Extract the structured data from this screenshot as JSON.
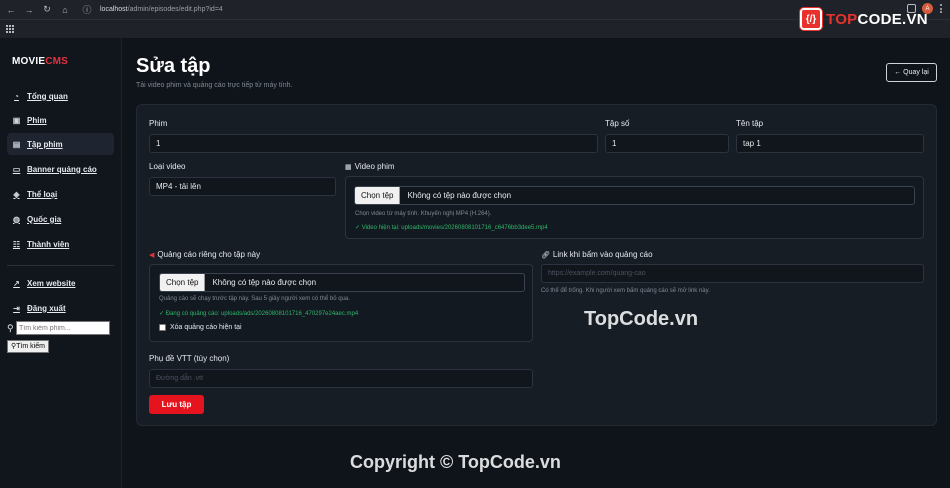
{
  "browser": {
    "url_host": "localhost",
    "url_path": "/admin/episodes/edit.php?id=4"
  },
  "watermark_logo": {
    "badge": "{/}",
    "text_a": "TOP",
    "text_b": "CODE.VN"
  },
  "avatar_letter": "A",
  "brand": {
    "a": "MOVIE",
    "b": "CMS"
  },
  "sidebar": {
    "items": [
      {
        "label": "Tổng quan",
        "icon": "gauge-icon"
      },
      {
        "label": "Phim",
        "icon": "film-icon"
      },
      {
        "label": "Tập phim",
        "icon": "clapper-icon",
        "active": true
      },
      {
        "label": "Banner quảng cáo",
        "icon": "ad-icon"
      },
      {
        "label": "Thể loại",
        "icon": "tag-icon"
      },
      {
        "label": "Quốc gia",
        "icon": "globe-icon"
      },
      {
        "label": "Thành viên",
        "icon": "users-icon"
      }
    ],
    "links": [
      {
        "label": "Xem website",
        "icon": "external-link-icon"
      },
      {
        "label": "Đăng xuất",
        "icon": "logout-icon"
      }
    ],
    "search": {
      "placeholder": "Tìm kiếm phim...",
      "button": "Tìm kiếm"
    }
  },
  "page": {
    "title": "Sửa tập",
    "subtitle": "Tải video phim và quảng cáo trực tiếp từ máy tính.",
    "back": "← Quay lại"
  },
  "form": {
    "movie": {
      "label": "Phim",
      "value": "1"
    },
    "episode_no": {
      "label": "Tập số",
      "value": "1"
    },
    "episode_name": {
      "label": "Tên tập",
      "value": "tap 1"
    },
    "video_type": {
      "label": "Loại video",
      "value": "MP4 - tải lên"
    },
    "video_file": {
      "label": "Video phim",
      "button": "Chọn tệp",
      "status": "Không có tệp nào được chọn",
      "hint": "Chọn video từ máy tính. Khuyến nghị MP4 (H.264).",
      "current": "✓ Video hiện tại: uploads/movies/20260808101716_c6476bb3dee5.mp4"
    },
    "ad_file": {
      "label": "Quảng cáo riêng cho tập này",
      "button": "Chọn tệp",
      "status": "Không có tệp nào được chọn",
      "hint": "Quảng cáo sẽ chạy trước tập này. Sau 5 giây người xem có thể bỏ qua.",
      "current": "✓ Đang có quảng cáo: uploads/ads/20260808101716_470297e24aec.mp4",
      "remove_label": "Xóa quảng cáo hiện tại"
    },
    "ad_link": {
      "label": "Link khi bấm vào quảng cáo",
      "placeholder": "https://example.com/quang-cao",
      "hint": "Có thể để trống. Khi người xem bấm quảng cáo sẽ mở link này."
    },
    "subtitle_vtt": {
      "label": "Phụ đề VTT (tùy chọn)",
      "placeholder": "Đường dẫn .vtt"
    },
    "save": "Lưu tập"
  },
  "watermarks": {
    "center": "TopCode.vn",
    "bottom": "Copyright © TopCode.vn"
  }
}
